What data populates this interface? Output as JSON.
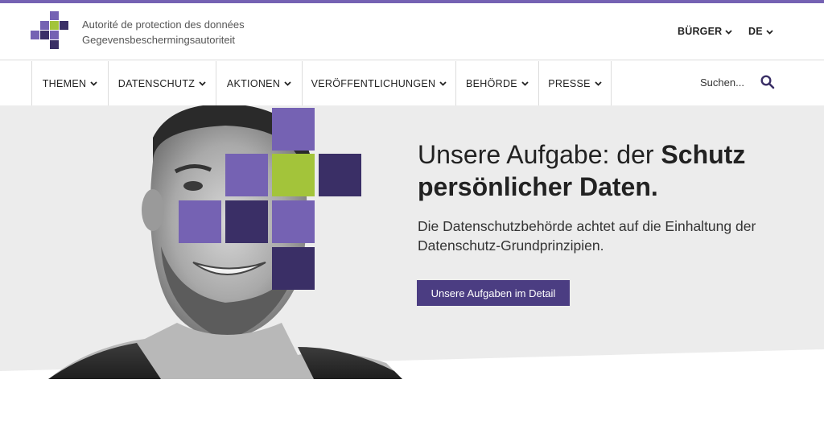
{
  "colors": {
    "accent": "#7562b3",
    "accent_dark": "#3a2f66",
    "lime": "#a3c43a",
    "button_bg": "#4b3d82"
  },
  "header": {
    "org_line1": "Autorité de protection des données",
    "org_line2": "Gegevensbeschermingsautoriteit",
    "audience_menu": "BÜRGER",
    "language_menu": "DE"
  },
  "nav": {
    "items": [
      {
        "label": "THEMEN"
      },
      {
        "label": "DATENSCHUTZ"
      },
      {
        "label": "AKTIONEN"
      },
      {
        "label": "VERÖFFENTLICHUNGEN"
      },
      {
        "label": "BEHÖRDE"
      },
      {
        "label": "PRESSE"
      }
    ],
    "search_placeholder": "Suchen..."
  },
  "hero": {
    "headline_regular": "Unsere Aufgabe: der ",
    "headline_bold_1": "Schutz",
    "headline_bold_2": "persönlicher Daten.",
    "subline": "Die Datenschutzbehörde achtet auf die Einhaltung der Datenschutz-Grundprinzipien.",
    "cta_label": "Unsere Aufgaben im Detail"
  }
}
